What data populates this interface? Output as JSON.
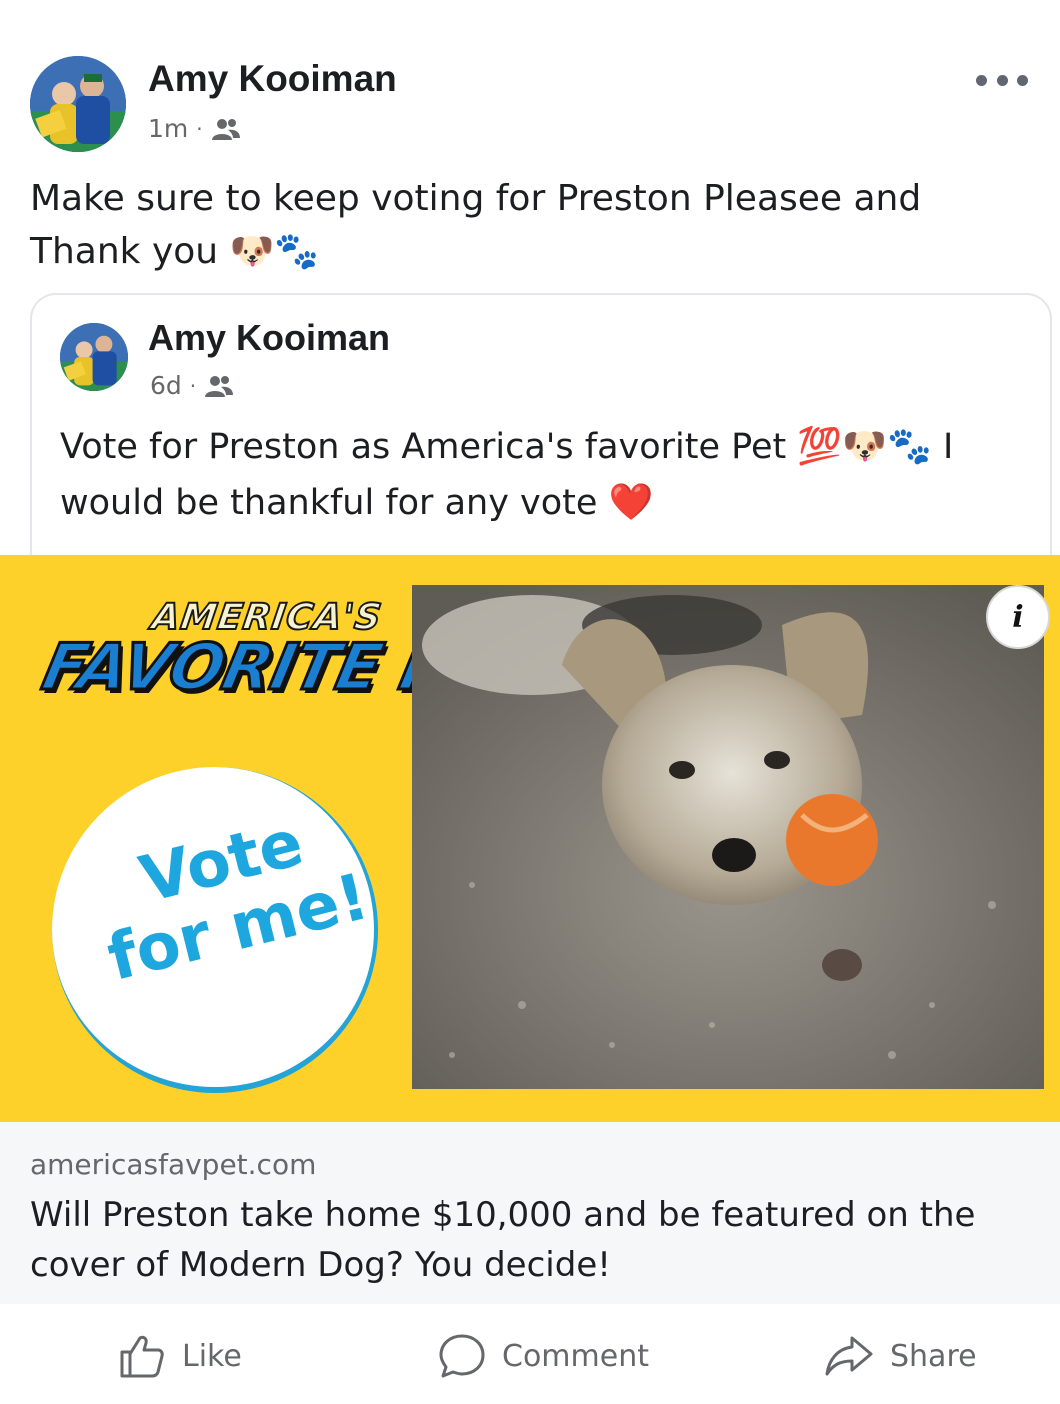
{
  "post": {
    "author": "Amy Kooiman",
    "time": "1m",
    "separator": "·",
    "audience_icon": "friends-icon",
    "text": "Make sure to keep voting for Preston Pleasee and Thank you",
    "emojis": "🐶🐾",
    "more_icon": "more-options-icon"
  },
  "shared_post": {
    "author": "Amy Kooiman",
    "time": "6d",
    "separator": "·",
    "audience_icon": "friends-icon",
    "text_part1": "Vote for Preston as America's favorite Pet",
    "emojis_mid": "💯🐶🐾",
    "text_part2": "I would be thankful for any vote",
    "emoji_end": "❤️"
  },
  "link_preview": {
    "image_logo_top": "AMERICA'S",
    "image_logo_main": "FAVORITE PET",
    "image_vote_line1": "Vote",
    "image_vote_line2": "for me!",
    "info_label": "i",
    "domain": "americasfavpet.com",
    "title": "Will Preston take home $10,000 and be featured on the cover of Modern Dog? You decide!",
    "colors": {
      "background": "#fdd129",
      "logo_blue": "#1b7fd1",
      "vote_blue": "#1ea7df"
    }
  },
  "actions": {
    "like": {
      "label": "Like",
      "icon": "thumbs-up-icon"
    },
    "comment": {
      "label": "Comment",
      "icon": "comment-icon"
    },
    "share": {
      "label": "Share",
      "icon": "share-icon"
    }
  }
}
